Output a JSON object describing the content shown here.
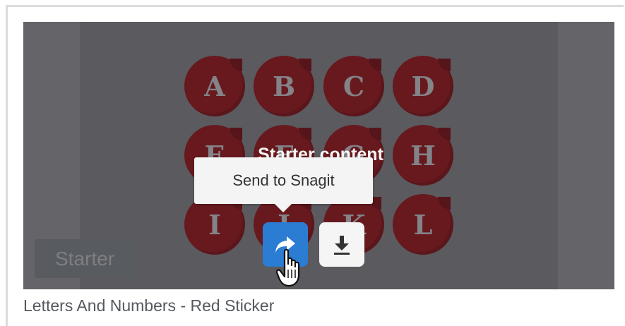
{
  "thumbnail": {
    "overlay_title": "Starter content",
    "tooltip": "Send to Snagit",
    "badge": "Starter",
    "stickers": [
      "A",
      "B",
      "C",
      "D",
      "E",
      "F",
      "G",
      "H",
      "I",
      "J",
      "K",
      "L"
    ]
  },
  "actions": {
    "share_icon": "share-arrow-icon",
    "download_icon": "download-icon"
  },
  "caption": "Letters And Numbers - Red Sticker",
  "colors": {
    "share_button": "#2b7cd3",
    "sticker_red": "#6e1217",
    "overlay": "#6b6b6f"
  }
}
